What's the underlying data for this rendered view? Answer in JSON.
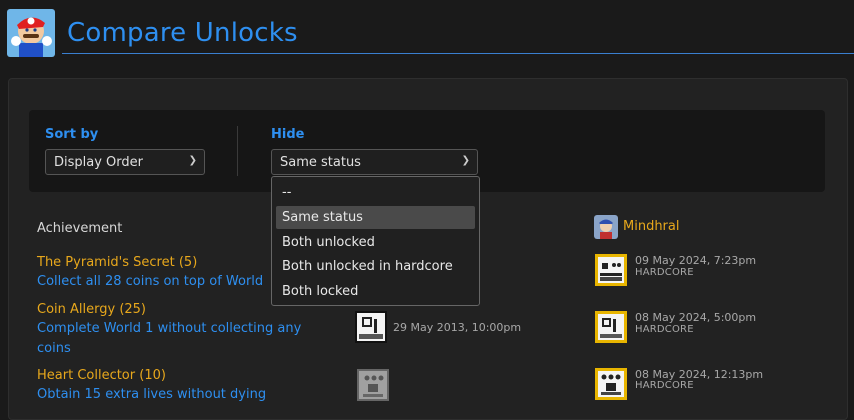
{
  "header": {
    "title": "Compare Unlocks",
    "game_icon": "mario-game-icon"
  },
  "filters": {
    "sort_label": "Sort by",
    "sort_value": "Display Order",
    "hide_label": "Hide",
    "hide_value": "Same status",
    "hide_options": [
      "--",
      "Same status",
      "Both unlocked",
      "Both unlocked in hardcore",
      "Both locked"
    ],
    "hide_selected_index": 1
  },
  "table": {
    "column_achievement": "Achievement",
    "player_name": "Mindhral",
    "rows": [
      {
        "title": "The Pyramid's Secret (5)",
        "description": "Collect all 28 coins on top of World",
        "other_date": "",
        "player_date": "09 May 2024, 7:23pm",
        "player_mode": "HARDCORE"
      },
      {
        "title": "Coin Allergy (25)",
        "description": "Complete World 1 without collecting any coins",
        "other_date": "29 May 2013, 10:00pm",
        "player_date": "08 May 2024, 5:00pm",
        "player_mode": "HARDCORE"
      },
      {
        "title": "Heart Collector (10)",
        "description": "Obtain 15 extra lives without dying",
        "other_date": "",
        "player_date": "08 May 2024, 12:13pm",
        "player_mode": "HARDCORE"
      }
    ]
  },
  "colors": {
    "accent_blue": "#2e8ff0",
    "gold": "#e8a81c",
    "badge_gold_border": "#e8b500"
  }
}
